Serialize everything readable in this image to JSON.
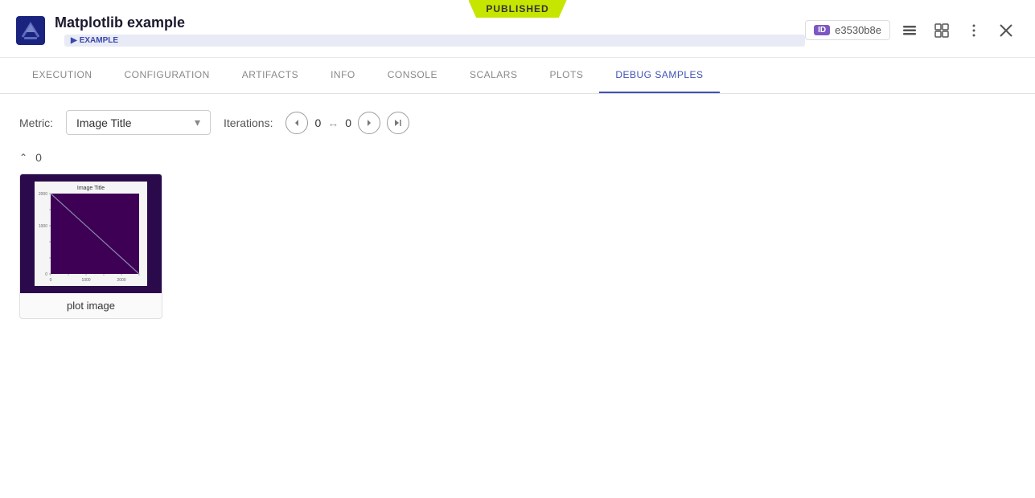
{
  "published_label": "PUBLISHED",
  "header": {
    "title": "Matplotlib example",
    "badge_label": "EXAMPLE",
    "id_label": "ID",
    "id_value": "e3530b8e"
  },
  "nav": {
    "tabs": [
      {
        "id": "execution",
        "label": "EXECUTION"
      },
      {
        "id": "configuration",
        "label": "CONFIGURATION"
      },
      {
        "id": "artifacts",
        "label": "ARTIFACTS"
      },
      {
        "id": "info",
        "label": "INFO"
      },
      {
        "id": "console",
        "label": "CONSOLE"
      },
      {
        "id": "scalars",
        "label": "SCALARS"
      },
      {
        "id": "plots",
        "label": "PLOTS"
      },
      {
        "id": "debug_samples",
        "label": "DEBUG SAMPLES"
      }
    ],
    "active": "debug_samples"
  },
  "metric": {
    "label": "Metric:",
    "value": "Image Title",
    "dropdown_arrow": "▼"
  },
  "iterations": {
    "label": "Iterations:",
    "from": "0",
    "to": "0"
  },
  "section": {
    "value": "0"
  },
  "image_card": {
    "label": "plot image"
  },
  "icons": {
    "logo": "🎓",
    "prev": "◀",
    "range": "↔",
    "next": "▶",
    "last": "⏭",
    "menu": "≡",
    "close": "✕",
    "list_icon": "☰",
    "grid_icon": "⊞",
    "example_arrow": "▶"
  }
}
